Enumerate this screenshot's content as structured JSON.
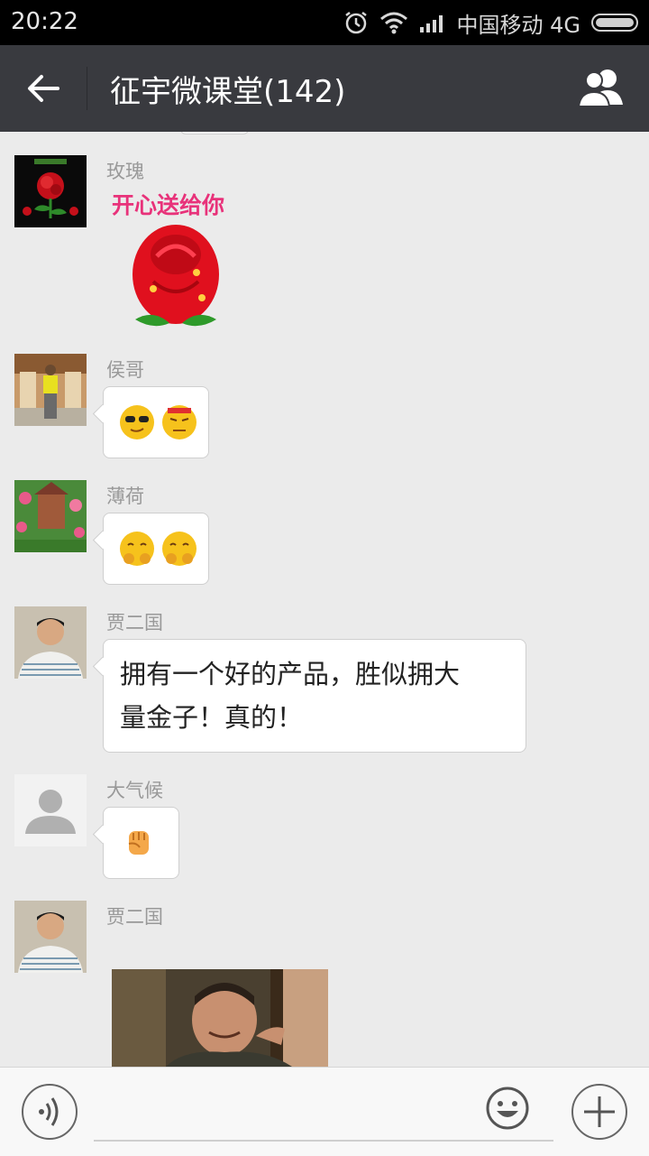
{
  "status_bar": {
    "time": "20:22",
    "carrier": "中国移动 4G",
    "icons": [
      "alarm-icon",
      "wifi-icon",
      "signal-icon",
      "battery-icon"
    ]
  },
  "header": {
    "title": "征宇微课堂(142)",
    "back_icon": "back-arrow-icon",
    "members_icon": "group-members-icon"
  },
  "messages": [
    {
      "sender": "玫瑰",
      "type": "sticker",
      "sticker_text": "开心送给你"
    },
    {
      "sender": "侯哥",
      "type": "emoji",
      "emojis": [
        "cool-sunglasses-emoji",
        "annoyed-emoji"
      ]
    },
    {
      "sender": "薄荷",
      "type": "emoji",
      "emojis": [
        "giggle-emoji",
        "giggle-emoji"
      ]
    },
    {
      "sender": "贾二国",
      "type": "text",
      "text_line1": "拥有一个好的产品，胜似拥大",
      "text_line2": "量金子！真的！"
    },
    {
      "sender": "大气候",
      "type": "emoji",
      "emojis": [
        "fist-emoji"
      ]
    },
    {
      "sender": "贾二国",
      "type": "image"
    }
  ],
  "input_bar": {
    "voice_icon": "voice-icon",
    "emoji_icon": "emoji-face-icon",
    "plus_icon": "plus-icon",
    "input_value": ""
  },
  "colors": {
    "title_bar": "#393a3f",
    "background": "#ebebeb",
    "sticker_text": "#e8327a"
  }
}
